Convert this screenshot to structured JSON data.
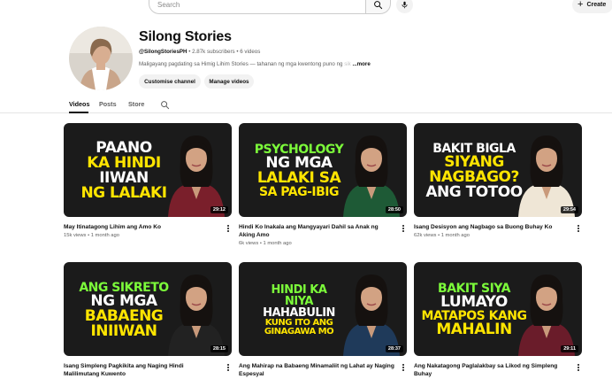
{
  "header": {
    "search_placeholder": "Search",
    "create_label": "Create"
  },
  "channel": {
    "name": "Silong Stories",
    "handle": "@SilongStoriesPH",
    "subscribers": "2.87k subscribers",
    "videos_count": "6 videos",
    "description": "Maligayang pagdating sa Himig Lihim Stories — tahanan ng mga kwentong puno ng ",
    "description_faded": "sik",
    "more_label": "...more",
    "customise_label": "Customise channel",
    "manage_label": "Manage videos"
  },
  "tabs": [
    {
      "label": "Videos",
      "active": true
    },
    {
      "label": "Posts",
      "active": false
    },
    {
      "label": "Store",
      "active": false
    }
  ],
  "videos": [
    {
      "thumb_lines": [
        "PAANO",
        "KA HINDI",
        "IIWAN",
        "NG LALAKI"
      ],
      "line_colors": [
        "#ffffff",
        "#ffe500",
        "#ffffff",
        "#ffe500"
      ],
      "duration": "29:12",
      "title": "May Itinatagong Lihim ang Amo Ko",
      "views": "15k views",
      "age": "1 month ago",
      "outfit": "#7a1f2b"
    },
    {
      "thumb_lines": [
        "PSYCHOLOGY",
        "NG MGA",
        "LALAKI SA",
        "SA PAG-IBIG"
      ],
      "line_colors": [
        "#7cfc3a",
        "#ffffff",
        "#ffe500",
        "#ffe500"
      ],
      "duration": "28:50",
      "title": "Hindi Ko Inakala ang Mangyayari Dahil sa Anak ng Aking Amo",
      "views": "6k views",
      "age": "1 month ago",
      "outfit": "#1e5a36"
    },
    {
      "thumb_lines": [
        "BAKIT BIGLA",
        "SIYANG",
        "NAGBAGO?",
        "ANG TOTOO"
      ],
      "line_colors": [
        "#ffffff",
        "#ffe500",
        "#ffe500",
        "#ffffff"
      ],
      "duration": "29:54",
      "title": "Isang Desisyon ang Nagbago sa Buong Buhay Ko",
      "views": "62k views",
      "age": "1 month ago",
      "outfit": "#efe6d6"
    },
    {
      "thumb_lines": [
        "ANG SIKRETO",
        "NG MGA",
        "BABAENG",
        "INIIWAN"
      ],
      "line_colors": [
        "#7cfc3a",
        "#ffffff",
        "#ffe500",
        "#ffe500"
      ],
      "duration": "28:15",
      "title": "Isang Simpleng Pagkikita ang Naging Hindi Malilimutang Kuwento",
      "views": "",
      "age": "",
      "outfit": "#222222"
    },
    {
      "thumb_lines": [
        "HINDI KA",
        "NIYA",
        "HAHABULIN",
        "KUNG ITO ANG",
        "GINAGAWA MO"
      ],
      "line_colors": [
        "#7cfc3a",
        "#7cfc3a",
        "#ffffff",
        "#ffe500",
        "#ffe500"
      ],
      "duration": "28:37",
      "title": "Ang Mahirap na Babaeng Minamaliit ng Lahat ay Naging Espesyal",
      "views": "",
      "age": "",
      "outfit": "#1f3a5a"
    },
    {
      "thumb_lines": [
        "BAKIT SIYA",
        "LUMAYO",
        "MATAPOS KANG",
        "MAHALIN"
      ],
      "line_colors": [
        "#7cfc3a",
        "#ffffff",
        "#ffe500",
        "#ffe500"
      ],
      "duration": "29:11",
      "title": "Ang Nakatagong Paglalakbay sa Likod ng Simpleng Buhay",
      "views": "",
      "age": "",
      "outfit": "#6a1c2a"
    }
  ]
}
